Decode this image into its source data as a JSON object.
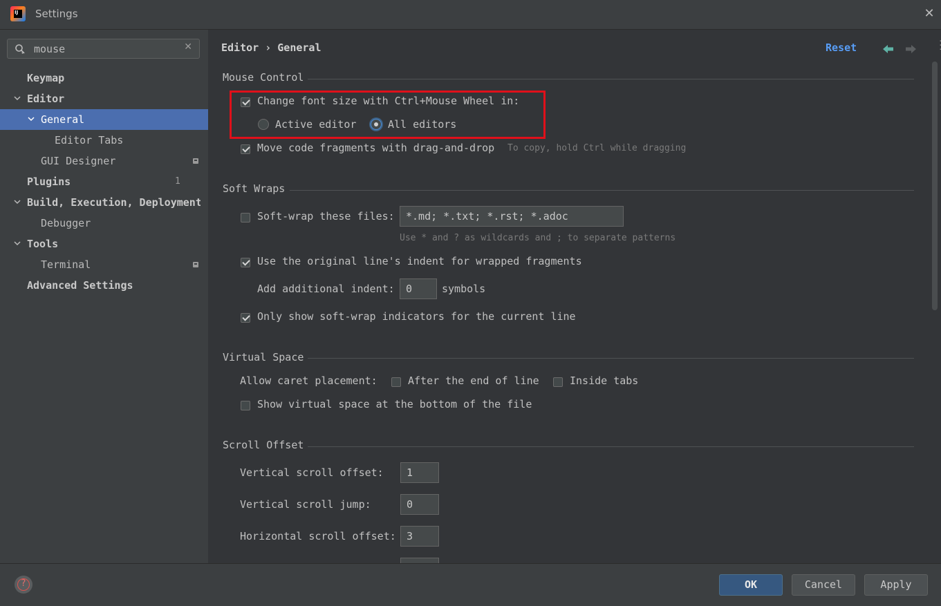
{
  "window": {
    "title": "Settings",
    "app_icon_text": "IJ"
  },
  "search": {
    "value": "mouse"
  },
  "tree": {
    "keymap": "Keymap",
    "editor": "Editor",
    "general": "General",
    "editor_tabs": "Editor Tabs",
    "gui_designer": "GUI Designer",
    "plugins": "Plugins",
    "plugins_count": "1",
    "build": "Build, Execution, Deployment",
    "debugger": "Debugger",
    "tools": "Tools",
    "terminal": "Terminal",
    "advanced": "Advanced Settings"
  },
  "header": {
    "crumb_parent": "Editor",
    "crumb_sep": "›",
    "crumb_current": "General",
    "reset": "Reset"
  },
  "mouse_control": {
    "title": "Mouse Control",
    "change_font_label": "Change font size with Ctrl+Mouse Wheel in:",
    "change_font_checked": true,
    "active_editor": "Active editor",
    "all_editors": "All editors",
    "selected": "All editors",
    "move_code_label": "Move code fragments with drag-and-drop",
    "move_code_checked": true,
    "move_code_hint": "To copy, hold Ctrl while dragging"
  },
  "soft_wraps": {
    "title": "Soft Wraps",
    "soft_wrap_label": "Soft-wrap these files:",
    "soft_wrap_checked": false,
    "soft_wrap_value": "*.md; *.txt; *.rst; *.adoc",
    "soft_wrap_hint": "Use * and ? as wildcards and ; to separate patterns",
    "orig_indent_label": "Use the original line's indent for wrapped fragments",
    "orig_indent_checked": true,
    "add_indent_label": "Add additional indent:",
    "add_indent_value": "0",
    "add_indent_unit": "symbols",
    "only_show_label": "Only show soft-wrap indicators for the current line",
    "only_show_checked": true
  },
  "virtual_space": {
    "title": "Virtual Space",
    "allow_caret_label": "Allow caret placement:",
    "after_end_label": "After the end of line",
    "inside_tabs_label": "Inside tabs",
    "show_virtual_label": "Show virtual space at the bottom of the file"
  },
  "scroll_offset": {
    "title": "Scroll Offset",
    "vertical_offset_label": "Vertical scroll offset:",
    "vertical_offset_value": "1",
    "vertical_jump_label": "Vertical scroll jump:",
    "vertical_jump_value": "0",
    "horizontal_offset_label": "Horizontal scroll offset:",
    "horizontal_offset_value": "3"
  },
  "footer": {
    "help": "?",
    "ok": "OK",
    "cancel": "Cancel",
    "apply": "Apply"
  }
}
